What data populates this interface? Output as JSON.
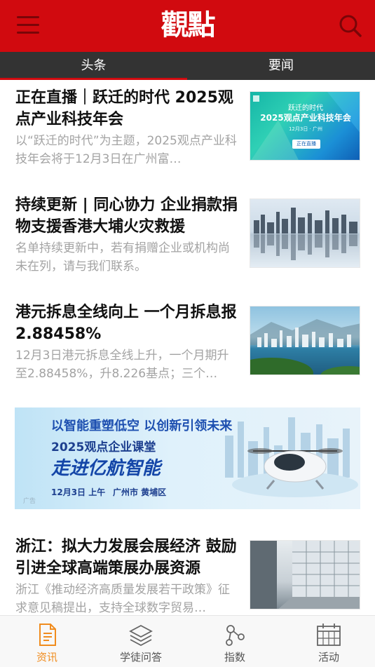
{
  "header": {
    "logo_text": "觀點",
    "menu_icon": "menu-icon",
    "search_icon": "search-icon",
    "brand_color": "#d10a0f"
  },
  "tabs": [
    {
      "label": "头条",
      "active": true
    },
    {
      "label": "要闻",
      "active": false
    }
  ],
  "articles": [
    {
      "title": "正在直播｜跃迁的时代 2025观点产业科技年会",
      "summary": "以“跃迁的时代”为主题，2025观点产业科技年会将于12月3日在广州富…",
      "thumb": {
        "top_text": "跃迁的时代",
        "main_text": "2025观点产业科技年会",
        "sub_text": "12月3日 · 广州",
        "button_text": "正在直播"
      }
    },
    {
      "title": "持续更新 | 同心协力 企业捐款捐物支援香港大埔火灾救援",
      "summary": "名单持续更新中，若有捐赠企业或机构尚未在列，请与我们联系。"
    },
    {
      "title": "港元拆息全线向上 一个月拆息报2.88458%",
      "summary": "12月3日港元拆息全线上升，一个月期升至2.88458%，升8.226基点；三个…"
    },
    {
      "title": "浙江：拟大力发展会展经济 鼓励引进全球高端策展办展资源",
      "summary": "浙江《推动经济高质量发展若干政策》征求意见稿提出，支持全球数字贸易…"
    }
  ],
  "ad": {
    "slogan": "以智能重塑低空 以创新引领未来",
    "subtitle": "2025观点企业课堂",
    "headline": "走进亿航智能",
    "date_info": "12月3日 上午",
    "location": "广州市 黄埔区",
    "tag": "广告"
  },
  "bottom_nav": [
    {
      "label": "资讯",
      "icon": "document-icon",
      "active": true
    },
    {
      "label": "学徒问答",
      "icon": "layers-icon",
      "active": false
    },
    {
      "label": "指数",
      "icon": "share-nodes-icon",
      "active": false
    },
    {
      "label": "活动",
      "icon": "calendar-icon",
      "active": false
    }
  ],
  "colors": {
    "accent_orange": "#f08c1e",
    "tab_bar": "#333333",
    "summary_gray": "#a3a3a3"
  }
}
